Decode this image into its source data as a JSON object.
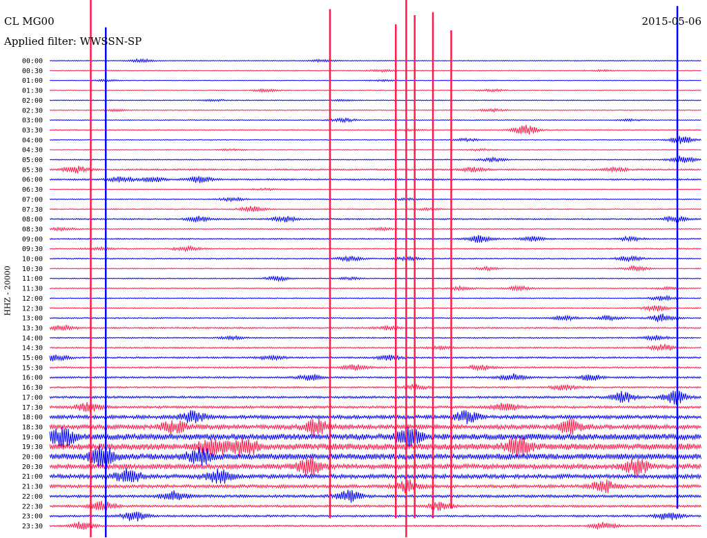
{
  "header": {
    "station": "CL MG00",
    "filter": "Applied filter: WWSSN-SP",
    "date": "2015-05-06",
    "channel": "HHZ - 20000"
  },
  "chart_data": {
    "type": "line",
    "title": "",
    "xlabel": "",
    "ylabel": "HHZ - 20000",
    "colors": [
      "#0000ff",
      "#ff1a4a"
    ],
    "rows": [
      {
        "label": "00:00",
        "level": 0.5,
        "events": [
          [
            0.14,
            0.7
          ],
          [
            0.42,
            0.6
          ]
        ]
      },
      {
        "label": "00:30",
        "level": 0.6,
        "events": [
          [
            0.51,
            0.5
          ],
          [
            0.85,
            0.3
          ]
        ]
      },
      {
        "label": "01:00",
        "level": 0.5,
        "events": [
          [
            0.09,
            0.4
          ],
          [
            0.51,
            0.3
          ]
        ]
      },
      {
        "label": "01:30",
        "level": 0.6,
        "events": [
          [
            0.33,
            0.6
          ],
          [
            0.68,
            0.5
          ]
        ]
      },
      {
        "label": "02:00",
        "level": 0.6,
        "events": [
          [
            0.25,
            0.4
          ],
          [
            0.45,
            0.3
          ]
        ]
      },
      {
        "label": "02:30",
        "level": 0.6,
        "events": [
          [
            0.1,
            0.4
          ],
          [
            0.68,
            0.6
          ]
        ]
      },
      {
        "label": "03:00",
        "level": 0.6,
        "events": [
          [
            0.45,
            0.8
          ],
          [
            0.89,
            0.4
          ]
        ]
      },
      {
        "label": "03:30",
        "level": 0.7,
        "events": [
          [
            0.73,
            2.2
          ],
          [
            0.55,
            0.3
          ]
        ]
      },
      {
        "label": "04:00",
        "level": 0.6,
        "events": [
          [
            0.64,
            0.6
          ],
          [
            0.97,
            1.8
          ]
        ]
      },
      {
        "label": "04:30",
        "level": 0.6,
        "events": [
          [
            0.28,
            0.3
          ],
          [
            0.66,
            0.4
          ]
        ]
      },
      {
        "label": "05:00",
        "level": 0.7,
        "events": [
          [
            0.68,
            0.9
          ],
          [
            0.97,
            1.8
          ]
        ]
      },
      {
        "label": "05:30",
        "level": 1.1,
        "events": [
          [
            0.04,
            1.5
          ],
          [
            0.65,
            1.0
          ],
          [
            0.87,
            0.8
          ]
        ]
      },
      {
        "label": "06:00",
        "level": 1.1,
        "events": [
          [
            0.11,
            1.2
          ],
          [
            0.23,
            1.3
          ],
          [
            0.16,
            1.0
          ]
        ]
      },
      {
        "label": "06:30",
        "level": 0.6,
        "events": [
          [
            0.33,
            0.4
          ]
        ]
      },
      {
        "label": "07:00",
        "level": 0.7,
        "events": [
          [
            0.28,
            0.8
          ],
          [
            0.55,
            0.4
          ]
        ]
      },
      {
        "label": "07:30",
        "level": 0.8,
        "events": [
          [
            0.31,
            1.3
          ],
          [
            0.58,
            0.4
          ]
        ]
      },
      {
        "label": "08:00",
        "level": 1.0,
        "events": [
          [
            0.23,
            1.3
          ],
          [
            0.36,
            1.2
          ],
          [
            0.96,
            1.4
          ]
        ]
      },
      {
        "label": "08:30",
        "level": 0.8,
        "events": [
          [
            0.02,
            0.6
          ],
          [
            0.51,
            0.5
          ]
        ]
      },
      {
        "label": "09:00",
        "level": 0.9,
        "events": [
          [
            0.66,
            1.6
          ],
          [
            0.74,
            1.0
          ],
          [
            0.89,
            0.9
          ]
        ]
      },
      {
        "label": "09:30",
        "level": 0.9,
        "events": [
          [
            0.21,
            1.1
          ],
          [
            0.08,
            0.5
          ]
        ]
      },
      {
        "label": "10:00",
        "level": 0.9,
        "events": [
          [
            0.46,
            1.0
          ],
          [
            0.55,
            0.8
          ],
          [
            0.89,
            1.2
          ]
        ]
      },
      {
        "label": "10:30",
        "level": 0.7,
        "events": [
          [
            0.67,
            0.7
          ],
          [
            0.9,
            1.2
          ]
        ]
      },
      {
        "label": "11:00",
        "level": 0.7,
        "events": [
          [
            0.35,
            1.0
          ],
          [
            0.46,
            0.5
          ]
        ]
      },
      {
        "label": "11:30",
        "level": 0.8,
        "events": [
          [
            0.63,
            0.8
          ],
          [
            0.72,
            0.9
          ],
          [
            0.95,
            0.5
          ]
        ]
      },
      {
        "label": "12:00",
        "level": 0.7,
        "events": [
          [
            0.94,
            1.0
          ]
        ]
      },
      {
        "label": "12:30",
        "level": 0.8,
        "events": [
          [
            0.93,
            1.3
          ]
        ]
      },
      {
        "label": "13:00",
        "level": 0.9,
        "events": [
          [
            0.79,
            1.0
          ],
          [
            0.86,
            1.0
          ],
          [
            0.94,
            1.8
          ]
        ]
      },
      {
        "label": "13:30",
        "level": 1.1,
        "events": [
          [
            0.02,
            1.5
          ],
          [
            0.52,
            0.8
          ]
        ]
      },
      {
        "label": "14:00",
        "level": 0.9,
        "events": [
          [
            0.28,
            0.7
          ],
          [
            0.93,
            1.0
          ]
        ]
      },
      {
        "label": "14:30",
        "level": 1.0,
        "events": [
          [
            0.94,
            1.5
          ],
          [
            0.6,
            0.6
          ]
        ]
      },
      {
        "label": "15:00",
        "level": 1.2,
        "events": [
          [
            0.01,
            1.4
          ],
          [
            0.34,
            0.9
          ],
          [
            0.52,
            1.0
          ]
        ]
      },
      {
        "label": "15:30",
        "level": 1.2,
        "events": [
          [
            0.47,
            1.3
          ],
          [
            0.66,
            1.0
          ]
        ]
      },
      {
        "label": "16:00",
        "level": 1.3,
        "events": [
          [
            0.4,
            1.3
          ],
          [
            0.71,
            1.5
          ],
          [
            0.83,
            1.3
          ]
        ]
      },
      {
        "label": "16:30",
        "level": 1.2,
        "events": [
          [
            0.56,
            1.2
          ],
          [
            0.79,
            1.2
          ]
        ]
      },
      {
        "label": "17:00",
        "level": 1.6,
        "events": [
          [
            0.88,
            2.6
          ],
          [
            0.96,
            3.0
          ]
        ]
      },
      {
        "label": "17:30",
        "level": 1.8,
        "events": [
          [
            0.06,
            2.2
          ],
          [
            0.7,
            1.8
          ]
        ]
      },
      {
        "label": "18:00",
        "level": 2.6,
        "events": [
          [
            0.22,
            2.5
          ],
          [
            0.64,
            2.6
          ]
        ]
      },
      {
        "label": "18:30",
        "level": 3.2,
        "events": [
          [
            0.19,
            3.0
          ],
          [
            0.41,
            3.3
          ],
          [
            0.8,
            3.0
          ]
        ]
      },
      {
        "label": "19:00",
        "level": 4.2,
        "events": [
          [
            0.02,
            4.0
          ],
          [
            0.55,
            4.2
          ]
        ]
      },
      {
        "label": "19:30",
        "level": 4.6,
        "events": [
          [
            0.25,
            4.5
          ],
          [
            0.3,
            4.2
          ],
          [
            0.72,
            4.5
          ]
        ]
      },
      {
        "label": "20:00",
        "level": 4.2,
        "events": [
          [
            0.08,
            4.5
          ],
          [
            0.23,
            3.8
          ]
        ]
      },
      {
        "label": "20:30",
        "level": 3.6,
        "events": [
          [
            0.4,
            3.5
          ],
          [
            0.9,
            3.5
          ]
        ]
      },
      {
        "label": "21:00",
        "level": 3.0,
        "events": [
          [
            0.12,
            3.6
          ],
          [
            0.26,
            3.0
          ]
        ]
      },
      {
        "label": "21:30",
        "level": 2.4,
        "events": [
          [
            0.55,
            2.6
          ],
          [
            0.85,
            2.6
          ]
        ]
      },
      {
        "label": "22:00",
        "level": 2.0,
        "events": [
          [
            0.19,
            2.2
          ],
          [
            0.46,
            2.4
          ]
        ]
      },
      {
        "label": "22:30",
        "level": 1.6,
        "events": [
          [
            0.08,
            2.0
          ],
          [
            0.6,
            1.8
          ]
        ]
      },
      {
        "label": "23:00",
        "level": 1.4,
        "events": [
          [
            0.13,
            2.2
          ],
          [
            0.95,
            1.8
          ]
        ]
      },
      {
        "label": "23:30",
        "level": 1.2,
        "events": [
          [
            0.05,
            1.8
          ],
          [
            0.85,
            1.6
          ]
        ]
      }
    ],
    "spikes": [
      {
        "x": 0.063,
        "color": "#ff1a4a",
        "up": 1.0,
        "down": 1.0
      },
      {
        "x": 0.086,
        "color": "#0000ff",
        "up": 0.55,
        "down": 1.0
      },
      {
        "x": 0.43,
        "color": "#ff1a4a",
        "up": 0.85,
        "down": 0.96
      },
      {
        "x": 0.531,
        "color": "#ff1a4a",
        "up": 0.6,
        "down": 0.96
      },
      {
        "x": 0.547,
        "color": "#ff1a4a",
        "up": 1.0,
        "down": 1.0
      },
      {
        "x": 0.56,
        "color": "#ff1a4a",
        "up": 0.75,
        "down": 0.96
      },
      {
        "x": 0.588,
        "color": "#ff1a4a",
        "up": 0.8,
        "down": 0.96
      },
      {
        "x": 0.616,
        "color": "#ff1a4a",
        "up": 0.5,
        "down": 0.94
      },
      {
        "x": 0.963,
        "color": "#0000ff",
        "up": 0.9,
        "down": 0.94
      }
    ]
  }
}
